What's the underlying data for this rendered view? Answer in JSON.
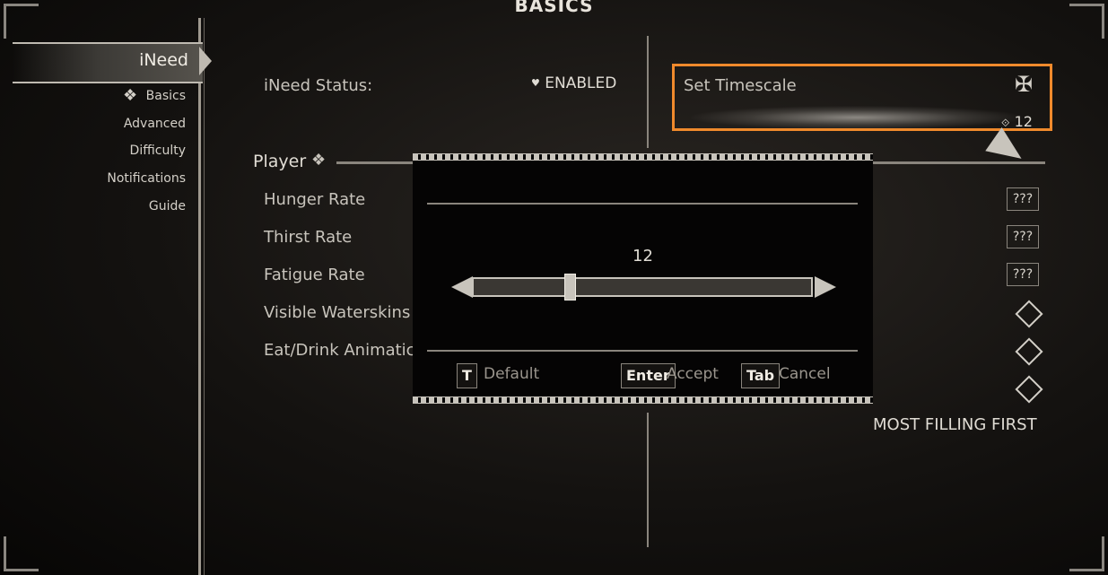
{
  "page": {
    "title": "BASICS"
  },
  "sidebar": {
    "mod_name": "iNeed",
    "items": [
      {
        "label": "Basics",
        "icon": "knot-icon"
      },
      {
        "label": "Advanced"
      },
      {
        "label": "Difficulty"
      },
      {
        "label": "Notifications"
      },
      {
        "label": "Guide"
      }
    ]
  },
  "settings": {
    "status": {
      "label": "iNeed Status:",
      "value": "ENABLED",
      "bullet": "♥"
    },
    "timescale": {
      "label": "Set Timescale",
      "value": "12",
      "icon_glyph": "⟐"
    },
    "player_header": "Player",
    "rows": [
      {
        "label": "Hunger Rate",
        "value": "???"
      },
      {
        "label": "Thirst Rate",
        "value": "???"
      },
      {
        "label": "Fatigue Rate",
        "value": "???"
      },
      {
        "label": "Visible Waterskins",
        "value": ""
      },
      {
        "label": "Eat/Drink Animatic",
        "value": ""
      }
    ],
    "sort_order": "MOST FILLING FIRST"
  },
  "dialog": {
    "slider_value": "12",
    "slider_fraction": 0.28,
    "buttons": [
      {
        "key": "T",
        "label": "Default"
      },
      {
        "key": "Enter",
        "label": "Accept"
      },
      {
        "key": "Tab",
        "label": "Cancel"
      }
    ]
  },
  "colors": {
    "highlight": "#f08a2c",
    "text": "#d8d4cc",
    "background": "#141210"
  }
}
